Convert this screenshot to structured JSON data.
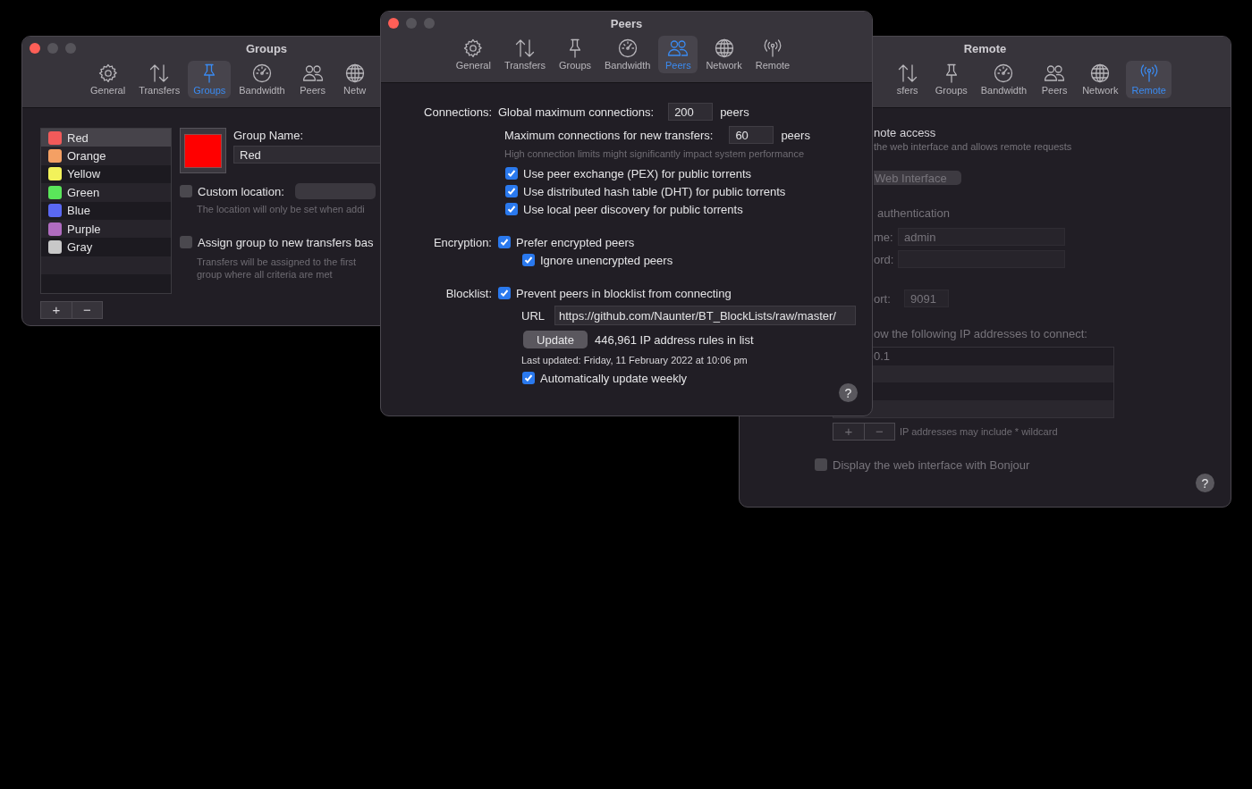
{
  "groups_window": {
    "title": "Groups",
    "controls": [
      {
        "kind": "close"
      },
      {
        "kind": "minimize"
      },
      {
        "kind": "zoom"
      }
    ],
    "tabs": [
      {
        "label": "General",
        "kind": "gear",
        "selected": false
      },
      {
        "label": "Transfers",
        "kind": "arrows",
        "selected": false
      },
      {
        "label": "Groups",
        "kind": "pin",
        "selected": true
      },
      {
        "label": "Bandwidth",
        "kind": "gauge",
        "selected": false
      },
      {
        "label": "Peers",
        "kind": "people",
        "selected": false
      },
      {
        "label": "Netw",
        "kind": "globe",
        "selected": false
      }
    ],
    "groups": [
      {
        "name": "Red",
        "color": "#f25a5a",
        "selected": true
      },
      {
        "name": "Orange",
        "color": "#f4a064",
        "selected": false
      },
      {
        "name": "Yellow",
        "color": "#f2f25a",
        "selected": false
      },
      {
        "name": "Green",
        "color": "#5ae65a",
        "selected": false
      },
      {
        "name": "Blue",
        "color": "#5a68f2",
        "selected": false
      },
      {
        "name": "Purple",
        "color": "#b06cc0",
        "selected": false
      },
      {
        "name": "Gray",
        "color": "#c8c8c8",
        "selected": false
      }
    ],
    "list_buttons": [
      "+",
      "−"
    ],
    "color_well": {
      "color": "#ff0000"
    },
    "group_name_label": "Group Name:",
    "group_name_value": "Red",
    "custom_location": {
      "label": "Custom location:",
      "checked": false,
      "hint": "The location will only be set when addi"
    },
    "assign_rule": {
      "label": "Assign group to new transfers bas",
      "checked": false,
      "hint": "Transfers will be assigned to the first group where all criteria are met"
    }
  },
  "peers_window": {
    "title": "Peers",
    "controls": [
      {
        "kind": "close"
      },
      {
        "kind": "minimize"
      },
      {
        "kind": "zoom"
      }
    ],
    "tabs": [
      {
        "label": "General",
        "kind": "gear",
        "selected": false
      },
      {
        "label": "Transfers",
        "kind": "arrows",
        "selected": false
      },
      {
        "label": "Groups",
        "kind": "pin",
        "selected": false
      },
      {
        "label": "Bandwidth",
        "kind": "gauge",
        "selected": false
      },
      {
        "label": "Peers",
        "kind": "people",
        "selected": true
      },
      {
        "label": "Network",
        "kind": "globe",
        "selected": false
      },
      {
        "label": "Remote",
        "kind": "antenna",
        "selected": false
      }
    ],
    "connections": {
      "label": "Connections:",
      "global_label": "Global maximum connections:",
      "global_value": "200",
      "global_unit": "peers",
      "new_label": "Maximum connections for new transfers:",
      "new_value": "60",
      "new_unit": "peers",
      "hint": "High connection limits might significantly impact system performance",
      "options": [
        {
          "label": "Use peer exchange (PEX) for public torrents",
          "checked": true
        },
        {
          "label": "Use distributed hash table (DHT) for public torrents",
          "checked": true
        },
        {
          "label": "Use local peer discovery for public torrents",
          "checked": true
        }
      ]
    },
    "encryption": {
      "label": "Encryption:",
      "prefer": {
        "label": "Prefer encrypted peers",
        "checked": true
      },
      "ignore": {
        "label": "Ignore unencrypted peers",
        "checked": true
      }
    },
    "blocklist": {
      "label": "Blocklist:",
      "prevent": {
        "label": "Prevent peers in blocklist from connecting",
        "checked": true
      },
      "url_label": "URL",
      "url_value": "https://github.com/Naunter/BT_BlockLists/raw/master/",
      "update_button": "Update",
      "rule_count": "446,961 IP address rules in list",
      "last_updated": "Last updated: Friday, 11 February 2022 at 10:06 pm",
      "auto_update": {
        "label": "Automatically update weekly",
        "checked": true
      }
    },
    "help_button": "?"
  },
  "remote_window": {
    "title": "Remote",
    "tabs": [
      {
        "label": "sfers",
        "kind": "arrows",
        "selected": false
      },
      {
        "label": "Groups",
        "kind": "pin",
        "selected": false
      },
      {
        "label": "Bandwidth",
        "kind": "gauge",
        "selected": false
      },
      {
        "label": "Peers",
        "kind": "people",
        "selected": false
      },
      {
        "label": "Network",
        "kind": "globe",
        "selected": false
      },
      {
        "label": "Remote",
        "kind": "antenna",
        "selected": true
      }
    ],
    "settings_disabled": true,
    "remote_access": {
      "label": "note access",
      "hint": "the web interface and allows remote requests"
    },
    "web_interface_button": "Web Interface",
    "authentication_label": "authentication",
    "username": {
      "label": "me:",
      "value": "admin"
    },
    "password": {
      "label": "ord:"
    },
    "port": {
      "label": "ort:",
      "value": "9091"
    },
    "allow_label": "ow the following IP addresses to connect:",
    "addresses": [
      "0.1"
    ],
    "list_buttons": [
      "+",
      "−"
    ],
    "wildcard_hint": "IP addresses may include * wildcard",
    "bonjour": {
      "label": "Display the web interface with Bonjour",
      "checked": false
    },
    "help_button": "?"
  }
}
